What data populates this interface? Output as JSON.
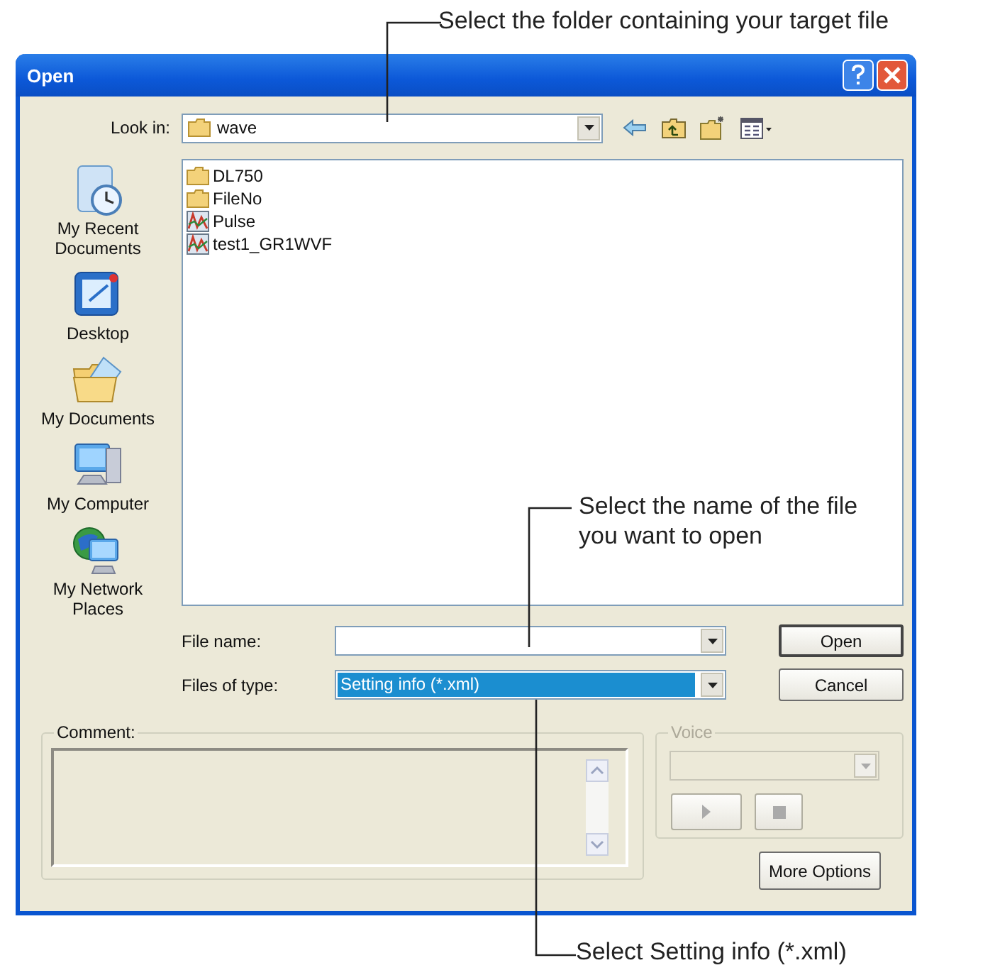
{
  "annotations": [
    {
      "text": "Select the folder containing your target file"
    },
    {
      "text": "Select the name of the file you want to open"
    },
    {
      "text": "Select Setting info (*.xml)"
    }
  ],
  "window": {
    "title": "Open"
  },
  "look_in": {
    "label": "Look in:",
    "value": "wave"
  },
  "places": [
    {
      "label": "My Recent Documents",
      "kind": "recent"
    },
    {
      "label": "Desktop",
      "kind": "desktop"
    },
    {
      "label": "My Documents",
      "kind": "documents"
    },
    {
      "label": "My Computer",
      "kind": "computer"
    },
    {
      "label": "My Network Places",
      "kind": "network"
    }
  ],
  "files": [
    {
      "name": "DL750",
      "kind": "folder"
    },
    {
      "name": "FileNo",
      "kind": "folder"
    },
    {
      "name": "Pulse",
      "kind": "wave"
    },
    {
      "name": "test1_GR1WVF",
      "kind": "wave"
    }
  ],
  "file_name": {
    "label": "File name:"
  },
  "files_of_type": {
    "label": "Files of type:",
    "value": "Setting info (*.xml)",
    "selected": true
  },
  "buttons": [
    {
      "label": "Open",
      "default": true
    },
    {
      "label": "Cancel",
      "default": false
    }
  ],
  "comment": {
    "label": "Comment:"
  },
  "voice": {
    "label": "Voice",
    "disabled": true
  },
  "more_options": {
    "label": "More Options"
  }
}
